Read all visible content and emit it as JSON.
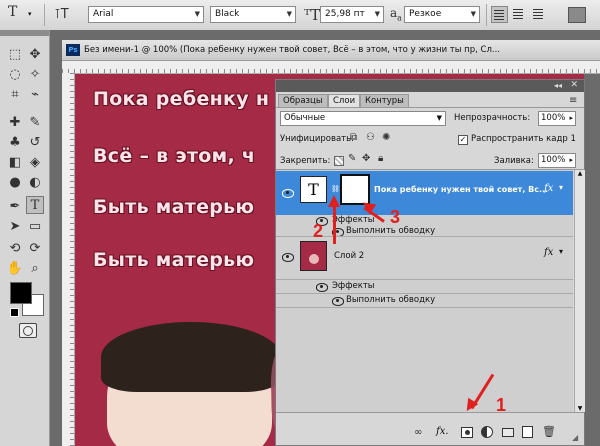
{
  "options_bar": {
    "tool_glyph": "T",
    "font_family": "Arial",
    "font_style": "Black",
    "font_size": "25,98 пт",
    "aa_label": "a",
    "aa_sublabel": "a",
    "antialias": "Резкое"
  },
  "document": {
    "icon": "Ps",
    "title": "Без имени-1 @ 100% (Пока ребенку нужен твой совет,  Всё – в этом, что у жизни ты пр, Сл..."
  },
  "canvas": {
    "background": "#a42a45",
    "lines": [
      "Пока ребенку н",
      "Всё – в этом, ч",
      "Быть матерью",
      "Быть матерью"
    ]
  },
  "layers_panel": {
    "tabs": [
      "Образцы",
      "Слои",
      "Контуры"
    ],
    "active_tab": "Слои",
    "blend_mode": "Обычные",
    "opacity_label": "Непрозрачность:",
    "opacity_value": "100%",
    "unify_label": "Унифицировать:",
    "propagate_label": "Распространить кадр 1",
    "lock_label": "Закрепить:",
    "fill_label": "Заливка:",
    "fill_value": "100%",
    "layers": [
      {
        "name": "Пока ребенку нужен твой совет,  Вс...",
        "thumb_glyph": "T",
        "fx": "fx",
        "selected": true,
        "effects_label": "Эффекты",
        "effect": "Выполнить обводку"
      },
      {
        "name": "Слой 2",
        "fx": "fx",
        "selected": false,
        "effects_label": "Эффекты",
        "effect": "Выполнить обводку"
      }
    ],
    "bottom_icons": [
      "link-icon",
      "fx-icon",
      "mask-icon",
      "adjustment-icon",
      "folder-icon",
      "new-layer-icon",
      "trash-icon"
    ],
    "fx_label": "fx."
  },
  "annotations": [
    "1",
    "2",
    "3"
  ],
  "accent_colors": {
    "selection": "#3d88d9",
    "arrow": "#e0201e"
  }
}
